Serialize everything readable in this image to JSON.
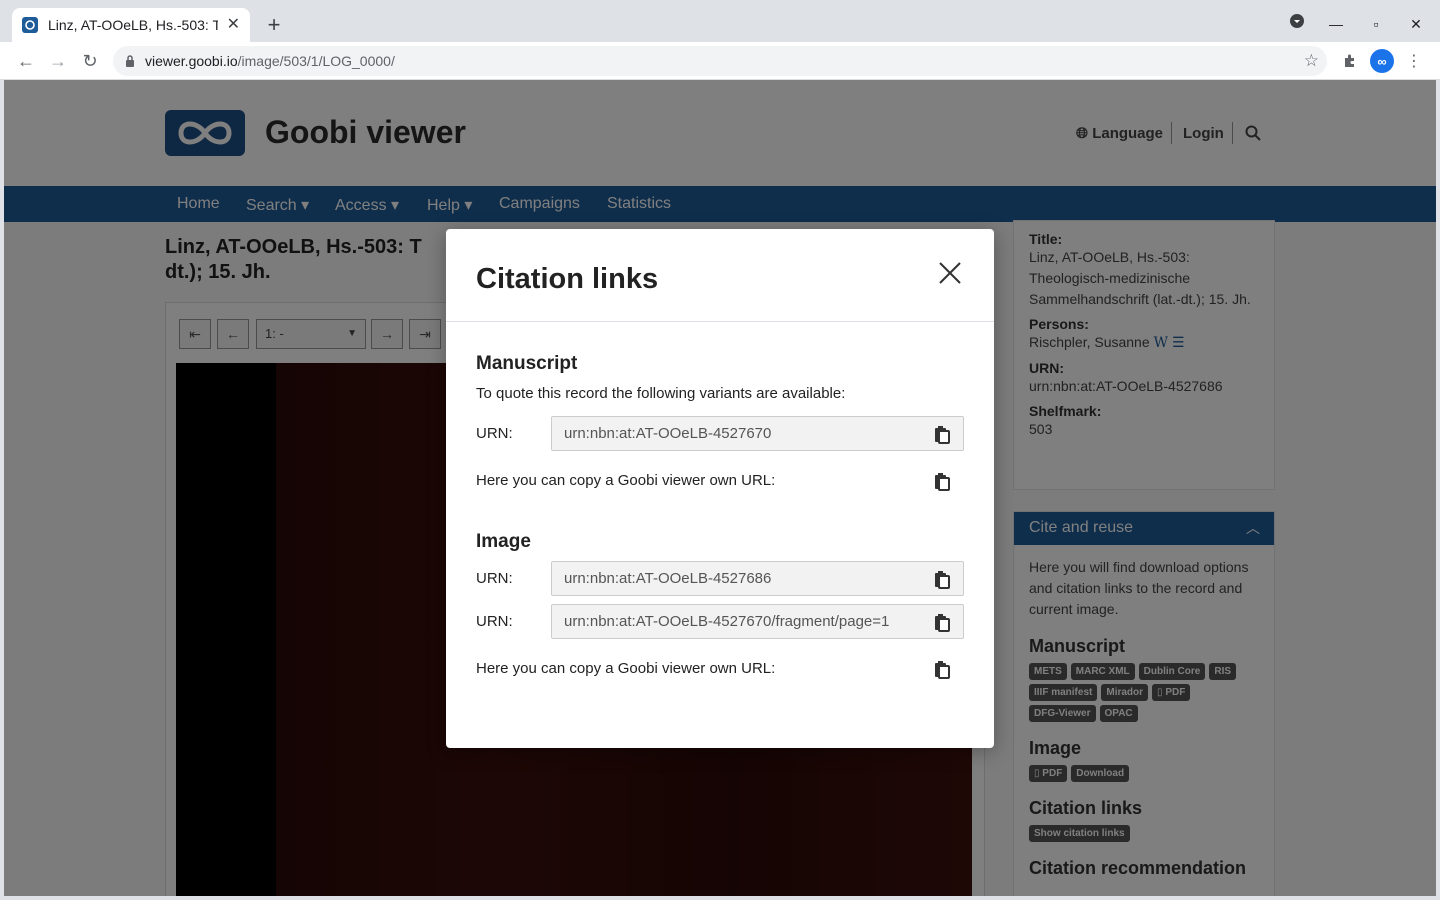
{
  "browser": {
    "tab_title": "Linz, AT-OOeLB, Hs.-503: T",
    "url_host": "viewer.goobi.io",
    "url_path": "/image/503/1/LOG_0000/"
  },
  "site": {
    "logo_text": "Goobi viewer",
    "header_links": [
      "Language",
      "Login"
    ],
    "nav": [
      "Home",
      "Search",
      "Access",
      "Help",
      "Campaigns",
      "Statistics"
    ]
  },
  "record": {
    "title": "Linz, AT-OOeLB, Hs.-503: T dt.); 15. Jh.",
    "page_select": "1: -",
    "meta": {
      "title_label": "Title:",
      "title_value": "Linz, AT-OOeLB, Hs.-503: Theologisch-medizinische Sammelhandschrift (lat.-dt.); 15. Jh.",
      "persons_label": "Persons:",
      "persons_value": "Rischpler, Susanne",
      "urn_label": "URN:",
      "urn_value": "urn:nbn:at:AT-OOeLB-4527686",
      "shelfmark_label": "Shelfmark:",
      "shelfmark_value": "503"
    }
  },
  "cite_panel": {
    "heading": "Cite and reuse",
    "intro": "Here you will find download options and citation links to the record and current image.",
    "manuscript_heading": "Manuscript",
    "manuscript_badges": [
      "METS",
      "MARC XML",
      "Dublin Core",
      "RIS",
      "IIIF manifest",
      "Mirador",
      "PDF",
      "DFG-Viewer",
      "OPAC"
    ],
    "image_heading": "Image",
    "image_badges": [
      "PDF",
      "Download"
    ],
    "citation_heading": "Citation links",
    "citation_button": "Show citation links",
    "recommendation_heading": "Citation recommendation"
  },
  "modal": {
    "title": "Citation links",
    "manuscript": {
      "heading": "Manuscript",
      "intro": "To quote this record the following variants are available:",
      "urn_label": "URN:",
      "urn_value": "urn:nbn:at:AT-OOeLB-4527670",
      "own_url_text": "Here you can copy a Goobi viewer own URL:"
    },
    "image": {
      "heading": "Image",
      "urn1_label": "URN:",
      "urn1_value": "urn:nbn:at:AT-OOeLB-4527686",
      "urn2_label": "URN:",
      "urn2_value": "urn:nbn:at:AT-OOeLB-4527670/fragment/page=1",
      "own_url_text": "Here you can copy a Goobi viewer own URL:"
    }
  }
}
